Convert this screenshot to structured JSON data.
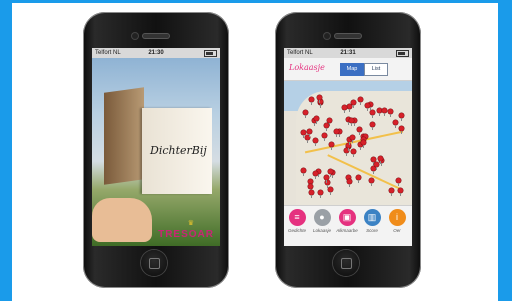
{
  "left_phone": {
    "status": {
      "carrier": "Telfort NL",
      "time": "21:30"
    },
    "book_title_main": "DichterBij",
    "brand": "TRESOAR"
  },
  "right_phone": {
    "status": {
      "carrier": "Telfort NL",
      "time": "21:31"
    },
    "app_title": "Lokaasje",
    "segments": [
      {
        "label": "Map",
        "active": true
      },
      {
        "label": "List",
        "active": false
      }
    ],
    "tabs": [
      {
        "label": "Gedichte",
        "color": "#e5317f",
        "icon": "list-icon"
      },
      {
        "label": "Lokaasje",
        "color": "#9aa0a6",
        "icon": "pin-icon"
      },
      {
        "label": "Alkmaarbe",
        "color": "#e5317f",
        "icon": "photo-icon"
      },
      {
        "label": "Score",
        "color": "#3b82c4",
        "icon": "book-icon"
      },
      {
        "label": "Oer",
        "color": "#f08c1a",
        "icon": "info-icon"
      }
    ]
  }
}
